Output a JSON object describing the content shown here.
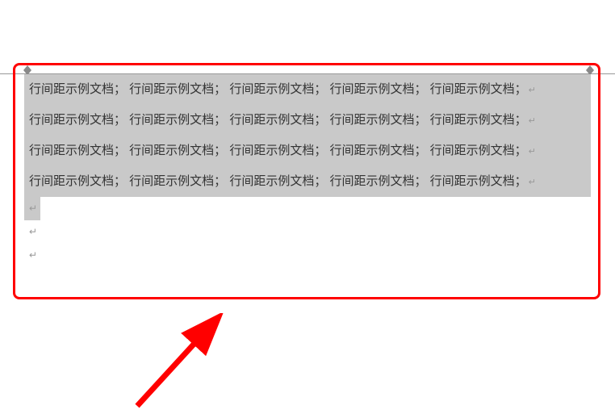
{
  "document": {
    "repeated_phrase": "行间距示例文档；",
    "separator": " ",
    "paragraph_mark": "↵",
    "lines": [
      "行间距示例文档； 行间距示例文档； 行间距示例文档； 行间距示例文档； 行间距示例文档；",
      "行间距示例文档； 行间距示例文档； 行间距示例文档； 行间距示例文档； 行间距示例文档；",
      "行间距示例文档； 行间距示例文档； 行间距示例文档； 行间距示例文档； 行间距示例文档；",
      "行间距示例文档； 行间距示例文档； 行间距示例文档； 行间距示例文档； 行间距示例文档；"
    ],
    "empty_paragraph_marks": [
      "↵",
      "↵",
      "↵"
    ]
  },
  "annotation": {
    "frame_color": "#ff0000",
    "arrow_color": "#ff0000"
  }
}
